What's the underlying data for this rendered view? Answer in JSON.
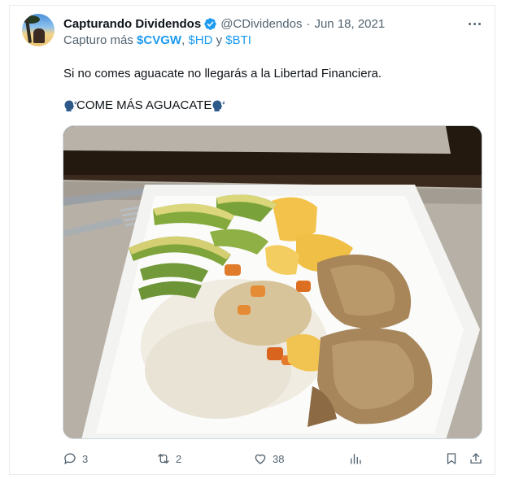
{
  "tweet": {
    "author_name": "Capturando Dividendos",
    "handle": "@CDividendos",
    "separator": "·",
    "date": "Jun 18, 2021",
    "reply_prefix": "Capturo más",
    "cashtag_1": "$CVGW",
    "sep_1": ",",
    "cashtag_2": "$HD",
    "sep_2": "y",
    "cashtag_3": "$BTI",
    "line_1": "Si no comes aguacate no llegarás a la Libertad Financiera.",
    "line_2": "COME MÁS AGUACATE",
    "verified_color": "#1d9bf0"
  },
  "actions": {
    "replies": "3",
    "retweets": "2",
    "likes": "38"
  },
  "icons": [
    "avatar",
    "verified-icon",
    "more-icon",
    "speaking-head-icon",
    "reply-icon",
    "retweet-icon",
    "like-icon",
    "views-icon",
    "bookmark-icon",
    "share-icon"
  ]
}
